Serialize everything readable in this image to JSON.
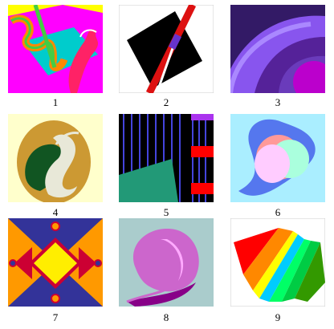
{
  "tiles": [
    {
      "label": "1"
    },
    {
      "label": "2"
    },
    {
      "label": "3"
    },
    {
      "label": "4"
    },
    {
      "label": "5"
    },
    {
      "label": "6"
    },
    {
      "label": "7"
    },
    {
      "label": "8"
    },
    {
      "label": "9"
    }
  ]
}
